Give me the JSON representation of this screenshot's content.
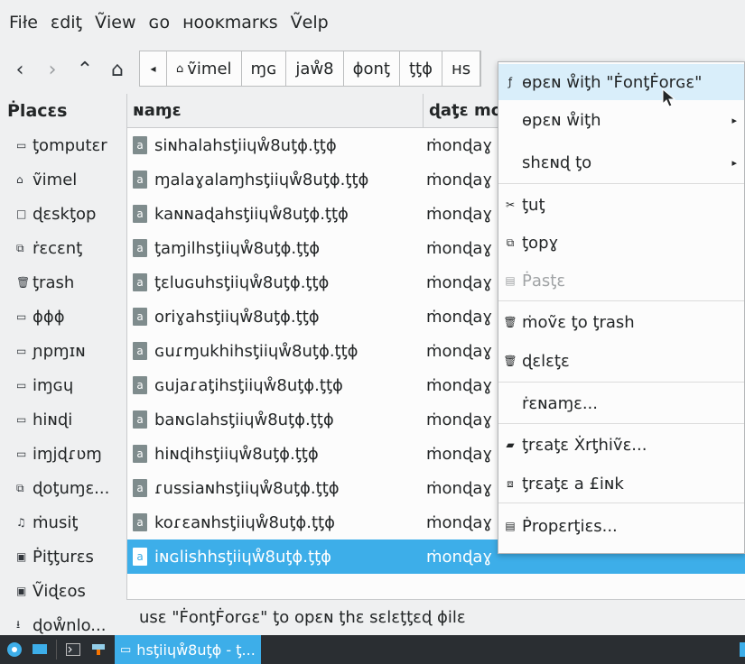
{
  "menubar": [
    "Fiłe",
    "ɛdiƫ",
    "Ṽiew",
    "ɢo",
    "ʜooĸmarĸs",
    "Ṽelp"
  ],
  "toolbar": {
    "back": "‹",
    "forward": "›",
    "up": "⌃",
    "home_icon": "⌂",
    "crumb_arrow": "◂",
    "crumbs": [
      "ṽimel",
      "ɱɢ",
      "jaẘ8",
      "ɸonƫ",
      "ƫƫɸ",
      "ʜs"
    ]
  },
  "places": {
    "title": "Ṗlacɛs",
    "items": [
      {
        "icon": "▭",
        "label": "ƫomputɛr"
      },
      {
        "icon": "⌂",
        "label": "ṽimel"
      },
      {
        "icon": "□",
        "label": "ɖɛskƫop"
      },
      {
        "icon": "⧉",
        "label": "ṙɛcɛnƫ"
      },
      {
        "icon": "🗑",
        "label": "ƫrash"
      },
      {
        "icon": "▭",
        "label": "ɸɸɸ"
      },
      {
        "icon": "▭",
        "label": "ɲpɱɪɴ"
      },
      {
        "icon": "▭",
        "label": "iɱɢɥ"
      },
      {
        "icon": "▭",
        "label": "hiɴɖi"
      },
      {
        "icon": "▭",
        "label": "iɱjɖɾʋɱ"
      },
      {
        "icon": "⧉",
        "label": "ɖoƫuɱɛ..."
      },
      {
        "icon": "♫",
        "label": "ṁusiƫ"
      },
      {
        "icon": "▣",
        "label": "Ṗiƫƫurɛs"
      },
      {
        "icon": "▣",
        "label": "Ṽiɖɛos"
      },
      {
        "icon": "⭳",
        "label": "ɖoẘnlo..."
      }
    ]
  },
  "filelist": {
    "col_name": "ɴaɱɛ",
    "col_date": "ɖaƫɛ mo",
    "rows": [
      {
        "name": "siɴhalahsƫiiɥẘ8uƫɸ.ƫƫɸ",
        "date": "ṁonɖaɣ"
      },
      {
        "name": "ɱalaɣalaɱhsƫiiɥẘ8uƫɸ.ƫƫɸ",
        "date": "ṁonɖaɣ"
      },
      {
        "name": "kaɴɴaɖahsƫiiɥẘ8uƫɸ.ƫƫɸ",
        "date": "ṁonɖaɣ"
      },
      {
        "name": "ƫaɱilhsƫiiɥẘ8uƫɸ.ƫƫɸ",
        "date": "ṁonɖaɣ"
      },
      {
        "name": "ƫɛluɢuhsƫiiɥẘ8uƫɸ.ƫƫɸ",
        "date": "ṁonɖaɣ"
      },
      {
        "name": "oriɣahsƫiiɥẘ8uƫɸ.ƫƫɸ",
        "date": "ṁonɖaɣ"
      },
      {
        "name": "ɢuɾɱukhihsƫiiɥẘ8uƫɸ.ƫƫɸ",
        "date": "ṁonɖaɣ"
      },
      {
        "name": "ɢujaɾaƫihsƫiiɥẘ8uƫɸ.ƫƫɸ",
        "date": "ṁonɖaɣ"
      },
      {
        "name": "baɴɢlahsƫiiɥẘ8uƫɸ.ƫƫɸ",
        "date": "ṁonɖaɣ"
      },
      {
        "name": "hiɴɖihsƫiiɥẘ8uƫɸ.ƫƫɸ",
        "date": "ṁonɖaɣ"
      },
      {
        "name": "ɾussiaɴhsƫiiɥẘ8uƫɸ.ƫƫɸ",
        "date": "ṁonɖaɣ"
      },
      {
        "name": "koɾɛaɴhsƫiiɥẘ8uƫɸ.ƫƫɸ",
        "date": "ṁonɖaɣ"
      },
      {
        "name": "iɴɢlishhsƫiiɥẘ8uƫɸ.ƫƫɸ",
        "date": "ṁonɖaɣ",
        "selected": true
      }
    ]
  },
  "status_text": "usɛ \"ḞonƫḞorɢɛ\" ƫo opɛɴ ƫhɛ sɛlɛƫƫɛɖ ɸilɛ",
  "context_menu": {
    "items": [
      {
        "icon": "ƒ",
        "label": "ɵpɛɴ ẘiƫh \"ḞonƫḞorɢɛ\"",
        "highlight": true
      },
      {
        "icon": "",
        "label": "ɵpɛɴ ẘiƫh",
        "submenu": true
      },
      {
        "icon": "",
        "label": "shɛɴɖ ƫo",
        "submenu": true
      },
      {
        "icon": "✂",
        "label": "ƫuƫ"
      },
      {
        "icon": "⧉",
        "label": "ƫopɣ"
      },
      {
        "icon": "▤",
        "label": "Ṗasƫɛ",
        "disabled": true
      },
      {
        "icon": "🗑",
        "label": "ṁoṽɛ ƫo ƫrash"
      },
      {
        "icon": "🗑",
        "label": "ɖɛlɛƫɛ"
      },
      {
        "icon": "",
        "label": "ṙɛɴaɱɛ..."
      },
      {
        "icon": "▰",
        "label": "ƫrɛaƫɛ Ẋrƫhiṽɛ..."
      },
      {
        "icon": "⧈",
        "label": "ƫrɛaƫɛ a £iɴk"
      },
      {
        "icon": "▤",
        "label": "Ṗropɛrƫiɛs..."
      }
    ]
  },
  "taskbar": {
    "task_label": "hsƫiiɥẘ8uƫɸ - ƫ..."
  },
  "colors": {
    "selection": "#3daee9",
    "taskbar": "#2a2e32",
    "window_bg": "#eff0f1"
  }
}
